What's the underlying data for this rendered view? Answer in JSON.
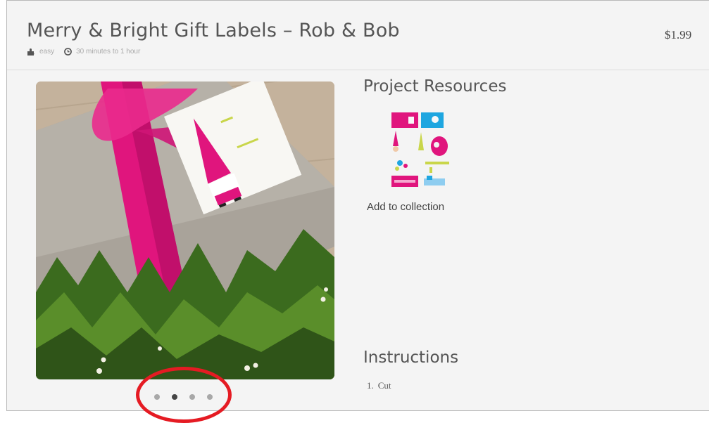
{
  "project": {
    "title": "Merry & Bright Gift Labels – Rob & Bob",
    "price": "$1.99",
    "difficulty": "easy",
    "duration": "30 minutes to 1 hour"
  },
  "resources": {
    "heading": "Project Resources",
    "add_label": "Add to collection"
  },
  "instructions": {
    "heading": "Instructions",
    "steps": [
      {
        "number": "1.",
        "text": "Cut"
      }
    ]
  },
  "carousel": {
    "slide_count": 4,
    "active_index": 1
  },
  "colors": {
    "ribbon": "#e0157d",
    "highlight": "#e51b23",
    "active_dot": "#444444",
    "inactive_dot": "#a8a8a8"
  },
  "icons": {
    "difficulty": "puzzle-piece-icon",
    "duration": "clock-icon"
  }
}
